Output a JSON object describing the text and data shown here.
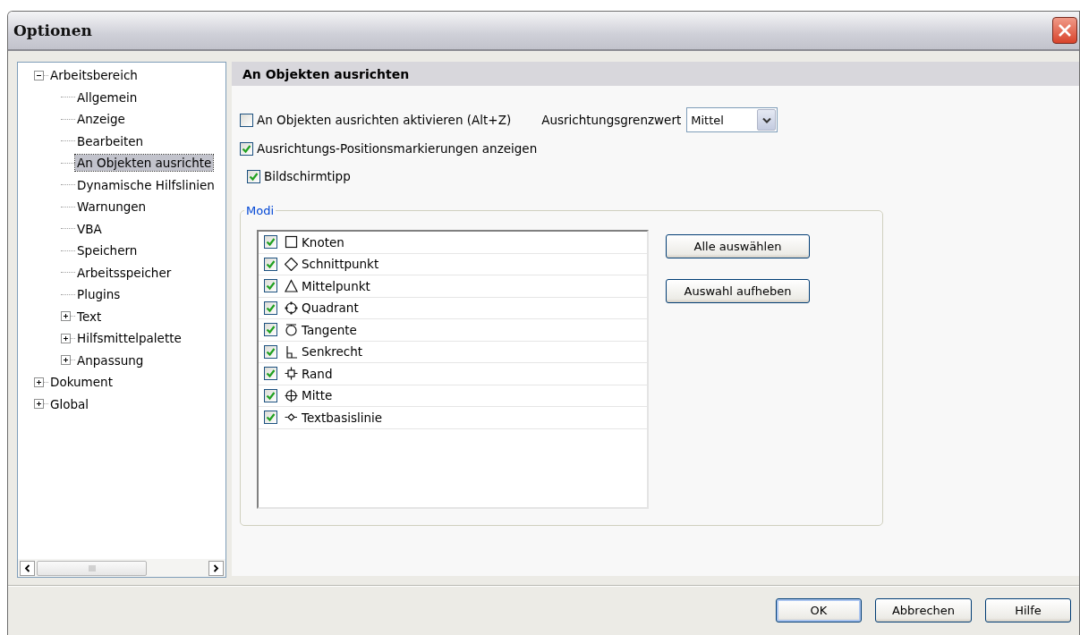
{
  "window": {
    "title": "Optionen"
  },
  "tree": [
    {
      "label": "Arbeitsbereich",
      "expanded": true,
      "selected": false,
      "children": [
        {
          "label": "Allgemein",
          "selected": false
        },
        {
          "label": "Anzeige",
          "selected": false
        },
        {
          "label": "Bearbeiten",
          "selected": false
        },
        {
          "label": "An Objekten ausrichte",
          "selected": true
        },
        {
          "label": "Dynamische Hilfslinien",
          "selected": false
        },
        {
          "label": "Warnungen",
          "selected": false
        },
        {
          "label": "VBA",
          "selected": false
        },
        {
          "label": "Speichern",
          "selected": false
        },
        {
          "label": "Arbeitsspeicher",
          "selected": false
        },
        {
          "label": "Plugins",
          "selected": false
        },
        {
          "label": "Text",
          "expanded": false,
          "selected": false
        },
        {
          "label": "Hilfsmittelpalette",
          "expanded": false,
          "selected": false
        },
        {
          "label": "Anpassung",
          "expanded": false,
          "selected": false
        }
      ]
    },
    {
      "label": "Dokument",
      "expanded": false,
      "selected": false
    },
    {
      "label": "Global",
      "expanded": false,
      "selected": false
    }
  ],
  "panel": {
    "title": "An Objekten ausrichten",
    "enable_snapping": {
      "label": "An Objekten ausrichten aktivieren (Alt+Z)",
      "checked": false
    },
    "threshold": {
      "label": "Ausrichtungsgrenzwert",
      "value": "Mittel"
    },
    "show_markers": {
      "label": "Ausrichtungs-Positionsmarkierungen anzeigen",
      "checked": true
    },
    "tooltip": {
      "label": "Bildschirmtipp",
      "checked": true
    },
    "modes": {
      "title": "Modi",
      "items": [
        {
          "label": "Knoten",
          "kind": "square",
          "checked": true
        },
        {
          "label": "Schnittpunkt",
          "kind": "diamond",
          "checked": true
        },
        {
          "label": "Mittelpunkt",
          "kind": "triangle",
          "checked": true
        },
        {
          "label": "Quadrant",
          "kind": "quadrant",
          "checked": true
        },
        {
          "label": "Tangente",
          "kind": "tangent",
          "checked": true
        },
        {
          "label": "Senkrecht",
          "kind": "perpendicular",
          "checked": true
        },
        {
          "label": "Rand",
          "kind": "edge",
          "checked": true
        },
        {
          "label": "Mitte",
          "kind": "center",
          "checked": true
        },
        {
          "label": "Textbasislinie",
          "kind": "baseline",
          "checked": true
        }
      ]
    },
    "mode_buttons": [
      "Alle auswählen",
      "Auswahl aufheben"
    ]
  },
  "buttons": [
    {
      "label": "OK",
      "default": true
    },
    {
      "label": "Abbrechen",
      "default": false
    },
    {
      "label": "Hilfe",
      "default": false
    }
  ]
}
